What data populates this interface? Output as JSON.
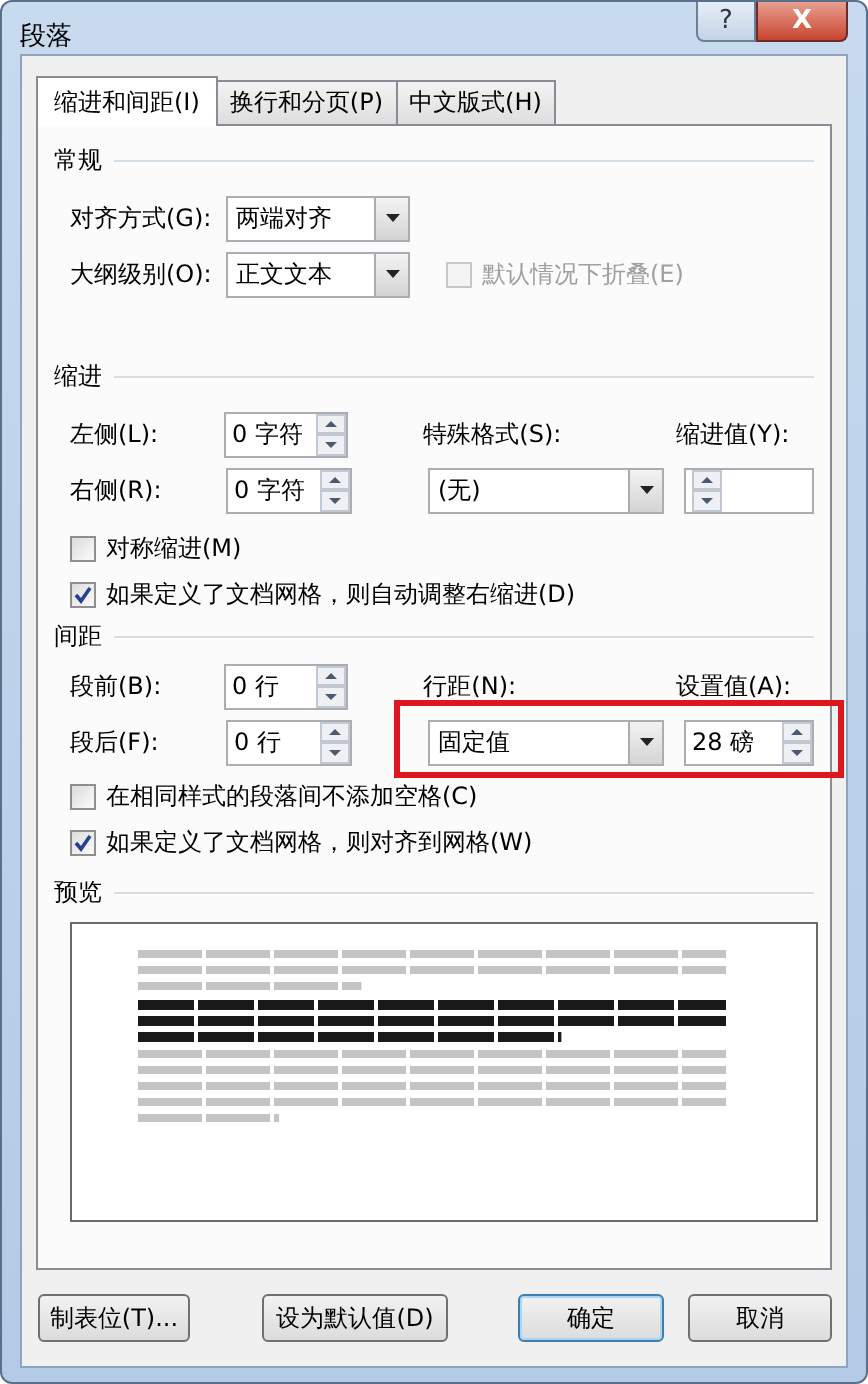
{
  "window": {
    "title": "段落",
    "help_button": "?",
    "close_button": "X"
  },
  "tabs": [
    {
      "label": "缩进和间距(I)",
      "selected": true
    },
    {
      "label": "换行和分页(P)",
      "selected": false
    },
    {
      "label": "中文版式(H)",
      "selected": false
    }
  ],
  "general": {
    "title": "常规",
    "alignment": {
      "label": "对齐方式(G):",
      "value": "两端对齐"
    },
    "outline_level": {
      "label": "大纲级别(O):",
      "value": "正文文本"
    },
    "collapse": {
      "label": "默认情况下折叠(E)",
      "checked": false,
      "disabled": true
    }
  },
  "indentation": {
    "title": "缩进",
    "left": {
      "label": "左侧(L):",
      "value": "0 字符"
    },
    "right": {
      "label": "右侧(R):",
      "value": "0 字符"
    },
    "special": {
      "label": "特殊格式(S):",
      "value": "(无)"
    },
    "by": {
      "label": "缩进值(Y):"
    },
    "checkboxes": [
      {
        "label": "对称缩进(M)",
        "checked": false
      },
      {
        "label": "如果定义了文档网格，则自动调整右缩进(D)",
        "checked": true
      }
    ]
  },
  "spacing": {
    "title": "间距",
    "before": {
      "label": "段前(B):",
      "value": "0 行"
    },
    "after": {
      "label": "段后(F):",
      "value": "0 行"
    },
    "line_spacing": {
      "label": "行距(N):",
      "value": "固定值"
    },
    "at": {
      "label": "设置值(A):",
      "value": "28 磅"
    },
    "highlighted": true,
    "checkboxes": [
      {
        "label": "在相同样式的段落间不添加空格(C)",
        "checked": false
      },
      {
        "label": "如果定义了文档网格，则对齐到网格(W)",
        "checked": true
      }
    ]
  },
  "preview": {
    "title": "预览"
  },
  "buttons": [
    {
      "label": "制表位(T)...",
      "default": false
    },
    {
      "label": "设为默认值(D)",
      "default": false
    },
    {
      "label": "确定",
      "default": true
    },
    {
      "label": "取消",
      "default": false
    }
  ]
}
